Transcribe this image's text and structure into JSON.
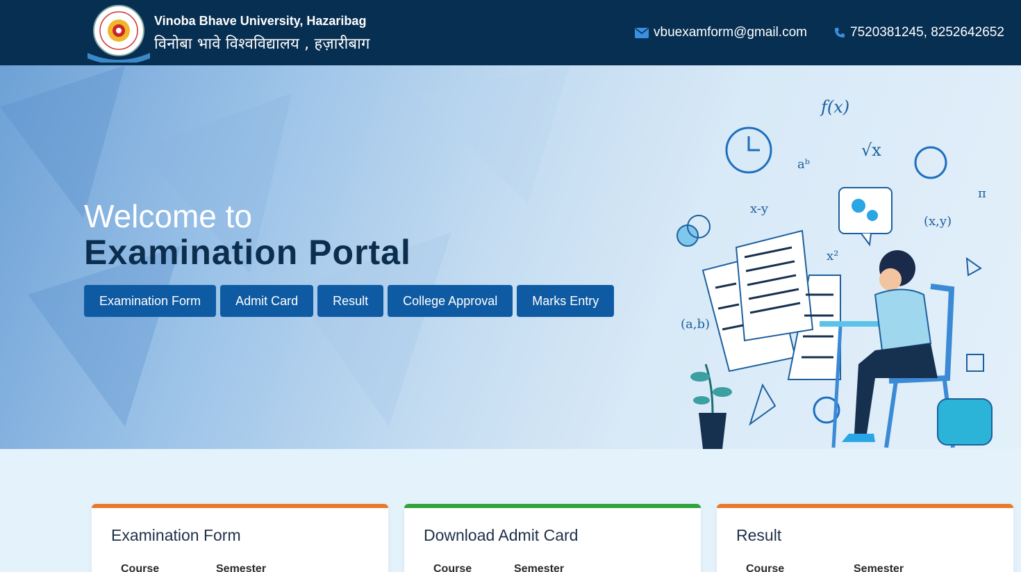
{
  "header": {
    "university_en": "Vinoba Bhave University, Hazaribag",
    "university_hi": "विनोबा भावे विश्वविद्यालय , हज़ारीबाग",
    "email": "vbuexamform@gmail.com",
    "phone": "7520381245, 8252642652"
  },
  "hero": {
    "welcome": "Welcome to",
    "title": "Examination Portal",
    "buttons": [
      "Examination Form",
      "Admit Card",
      "Result",
      "College Approval",
      "Marks Entry"
    ]
  },
  "cards": [
    {
      "title": "Examination Form",
      "col1": "Course",
      "col2": "Semester",
      "accent": "#e8792b"
    },
    {
      "title": "Download Admit Card",
      "col1": "Course",
      "col2": "Semester",
      "accent": "#2fa23a"
    },
    {
      "title": "Result",
      "col1": "Course",
      "col2": "Semester",
      "accent": "#e8792b"
    }
  ],
  "colors": {
    "header_bg": "#072f52",
    "button_bg": "#0f5ba3",
    "title": "#0c2e4e"
  }
}
